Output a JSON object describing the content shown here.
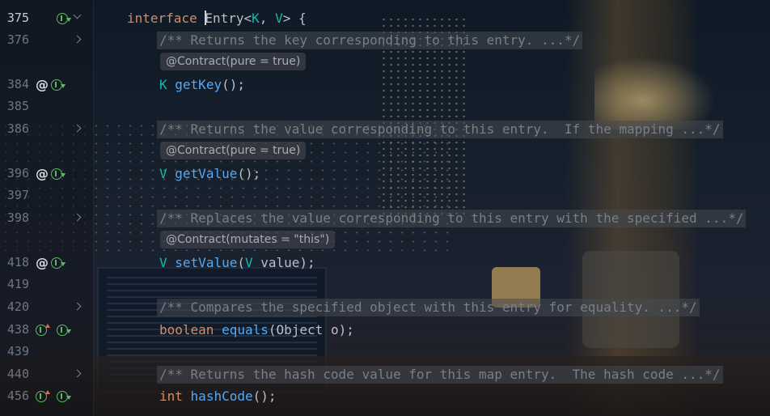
{
  "editor": {
    "lines": [
      {
        "num": "375",
        "icons": [
          "implemented"
        ],
        "fold": "down",
        "kw": "interface",
        "name_first": "E",
        "name_rest": "ntry",
        "lt": "<",
        "tp1": "K",
        "comma": ", ",
        "tp2": "V",
        "gt": ">",
        "brace": " {"
      },
      {
        "num": "376",
        "fold": "right",
        "doc": "/** Returns the key corresponding to this entry. ...*/"
      },
      {
        "anno": "@Contract(pure = true)"
      },
      {
        "num": "384",
        "icons": [
          "annotation",
          "implemented"
        ],
        "ret": "K",
        "fn": "getKey",
        "rest": "();"
      },
      {
        "num": "385"
      },
      {
        "num": "386",
        "fold": "right",
        "doc": "/** Returns the value corresponding to this entry.  If the mapping ...*/"
      },
      {
        "anno": "@Contract(pure = true)"
      },
      {
        "num": "396",
        "icons": [
          "annotation",
          "implemented"
        ],
        "ret": "V",
        "fn": "getValue",
        "rest": "();"
      },
      {
        "num": "397"
      },
      {
        "num": "398",
        "fold": "right",
        "doc": "/** Replaces the value corresponding to this entry with the specified ...*/"
      },
      {
        "anno": "@Contract(mutates = \"this\")"
      },
      {
        "num": "418",
        "icons": [
          "annotation",
          "implemented"
        ],
        "ret": "V",
        "fn": "setValue",
        "open": "(",
        "ptype": "V",
        "pname": " value",
        "close": ");"
      },
      {
        "num": "419"
      },
      {
        "num": "420",
        "fold": "right",
        "doc": "/** Compares the specified object with this entry for equality. ...*/"
      },
      {
        "num": "438",
        "icons": [
          "overrides",
          "implemented"
        ],
        "ret": "boolean",
        "fn": "equals",
        "rest": "(Object o);"
      },
      {
        "num": "439"
      },
      {
        "num": "440",
        "fold": "right",
        "doc": "/** Returns the hash code value for this map entry.  The hash code ...*/"
      },
      {
        "num": "456",
        "icons": [
          "overrides",
          "implemented"
        ],
        "ret": "int",
        "fn": "hashCode",
        "rest": "();"
      }
    ]
  },
  "colors": {
    "keyword": "#cf8e6d",
    "type_param": "#16baac",
    "method": "#56a8f5",
    "comment": "#7a7e85",
    "plain": "#bcbec4",
    "gutter_icon_green": "#5fb865",
    "override_arrow_red": "#e06b5b"
  }
}
